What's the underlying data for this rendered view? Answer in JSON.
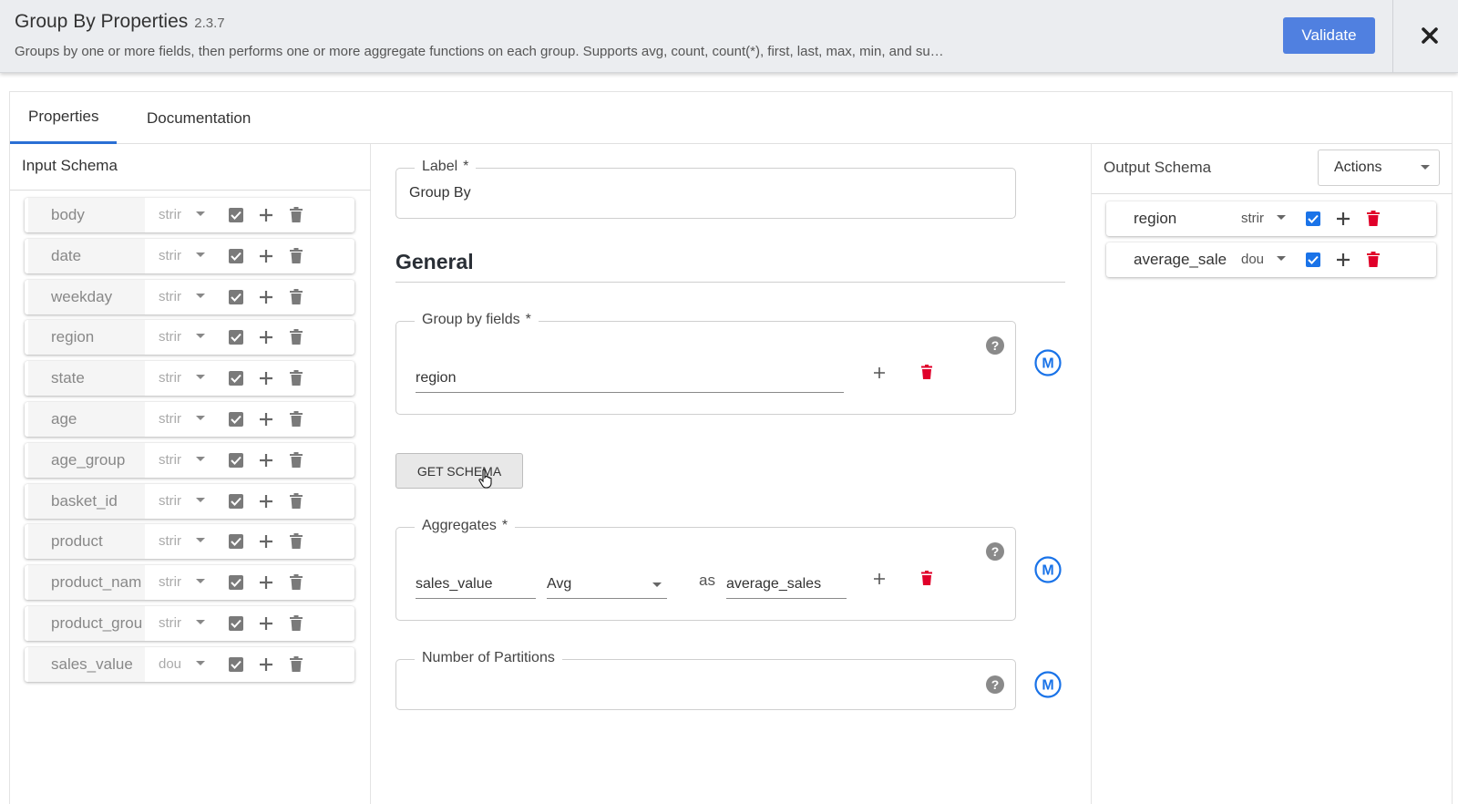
{
  "header": {
    "title": "Group By Properties",
    "version": "2.3.7",
    "description": "Groups by one or more fields, then performs one or more aggregate functions on each group. Supports avg, count, count(*), first, last, max, min, and su…",
    "validate_label": "Validate"
  },
  "tabs": [
    {
      "label": "Properties",
      "active": true
    },
    {
      "label": "Documentation",
      "active": false
    }
  ],
  "input_schema": {
    "title": "Input Schema",
    "fields": [
      {
        "name": "body",
        "type": "strir"
      },
      {
        "name": "date",
        "type": "strir"
      },
      {
        "name": "weekday",
        "type": "strir"
      },
      {
        "name": "region",
        "type": "strir"
      },
      {
        "name": "state",
        "type": "strir"
      },
      {
        "name": "age",
        "type": "strir"
      },
      {
        "name": "age_group",
        "type": "strir"
      },
      {
        "name": "basket_id",
        "type": "strir"
      },
      {
        "name": "product",
        "type": "strir"
      },
      {
        "name": "product_nam",
        "type": "strir"
      },
      {
        "name": "product_grou",
        "type": "strir"
      },
      {
        "name": "sales_value",
        "type": "dou"
      }
    ]
  },
  "main": {
    "label_field": {
      "legend": "Label",
      "required": "*",
      "value": "Group By"
    },
    "general_title": "General",
    "group_by": {
      "legend": "Group by fields",
      "required": "*",
      "value": "region"
    },
    "get_schema_label": "GET SCHEMA",
    "aggregates": {
      "legend": "Aggregates",
      "required": "*",
      "field": "sales_value",
      "function": "Avg",
      "as_text": "as",
      "alias": "average_sales"
    },
    "partitions": {
      "legend": "Number of Partitions",
      "value": ""
    },
    "m_label": "M"
  },
  "output_schema": {
    "title": "Output Schema",
    "actions_label": "Actions",
    "fields": [
      {
        "name": "region",
        "type": "strir"
      },
      {
        "name": "average_sale",
        "type": "dou"
      }
    ]
  },
  "colors": {
    "accent": "#2a6fd4",
    "validate": "#5080e0",
    "delete_red": "#e0002a",
    "m_blue": "#1a73e8"
  }
}
